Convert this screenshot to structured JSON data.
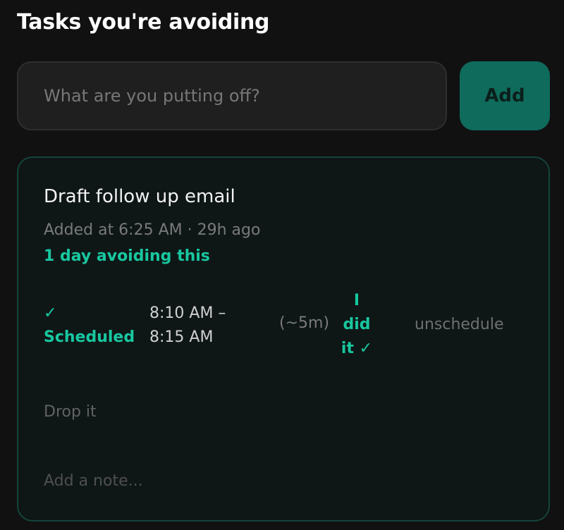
{
  "header": {
    "title": "Tasks you're avoiding"
  },
  "add_form": {
    "input_value": "",
    "input_placeholder": "What are you putting off?",
    "add_label": "Add"
  },
  "task": {
    "name": "Draft follow up email",
    "meta": "Added at 6:25 AM · 29h ago",
    "avoiding": "1 day avoiding this",
    "schedule": {
      "status_check": "✓",
      "status_label": "Scheduled",
      "start": "8:10 AM –",
      "end": "8:15 AM",
      "duration": "(~5m)",
      "did_it_line1": "I",
      "did_it_line2": "did",
      "did_it_line3": "it ✓",
      "unschedule_label": "unschedule"
    },
    "drop_label": "Drop it",
    "note_value": "",
    "note_placeholder": "Add a note..."
  },
  "colors": {
    "background": "#111111",
    "accent": "#18c7a0",
    "add_button": "#0f6b5c",
    "card_border": "#14443b"
  }
}
